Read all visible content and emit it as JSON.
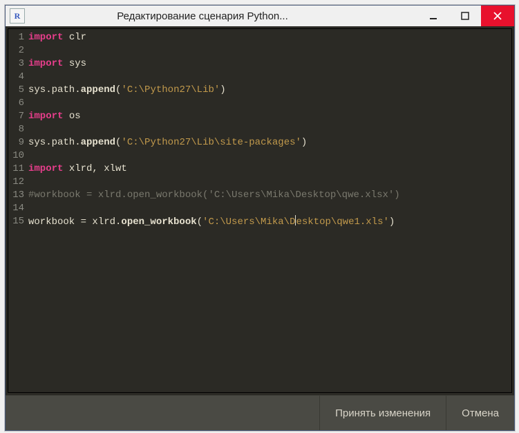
{
  "window": {
    "app_icon_letter": "R",
    "title": "Редактирование сценария Python..."
  },
  "code": {
    "lines": [
      {
        "n": 1,
        "tokens": [
          {
            "t": "kw",
            "v": "import"
          },
          {
            "t": "plain",
            "v": " clr"
          }
        ]
      },
      {
        "n": 2,
        "tokens": []
      },
      {
        "n": 3,
        "tokens": [
          {
            "t": "kw",
            "v": "import"
          },
          {
            "t": "plain",
            "v": " sys"
          }
        ]
      },
      {
        "n": 4,
        "tokens": []
      },
      {
        "n": 5,
        "tokens": [
          {
            "t": "plain",
            "v": "sys.path."
          },
          {
            "t": "fn",
            "v": "append"
          },
          {
            "t": "plain",
            "v": "("
          },
          {
            "t": "str",
            "v": "'C:\\Python27\\Lib'"
          },
          {
            "t": "plain",
            "v": ")"
          }
        ]
      },
      {
        "n": 6,
        "tokens": []
      },
      {
        "n": 7,
        "tokens": [
          {
            "t": "kw",
            "v": "import"
          },
          {
            "t": "plain",
            "v": " os"
          }
        ]
      },
      {
        "n": 8,
        "tokens": []
      },
      {
        "n": 9,
        "tokens": [
          {
            "t": "plain",
            "v": "sys.path."
          },
          {
            "t": "fn",
            "v": "append"
          },
          {
            "t": "plain",
            "v": "("
          },
          {
            "t": "str",
            "v": "'C:\\Python27\\Lib\\site-packages'"
          },
          {
            "t": "plain",
            "v": ")"
          }
        ]
      },
      {
        "n": 10,
        "tokens": []
      },
      {
        "n": 11,
        "tokens": [
          {
            "t": "kw",
            "v": "import"
          },
          {
            "t": "plain",
            "v": " xlrd, xlwt"
          }
        ]
      },
      {
        "n": 12,
        "tokens": []
      },
      {
        "n": 13,
        "tokens": [
          {
            "t": "cmt",
            "v": "#workbook = xlrd.open_workbook('C:\\Users\\Mika\\Desktop\\qwe.xlsx')"
          }
        ]
      },
      {
        "n": 14,
        "tokens": []
      },
      {
        "n": 15,
        "tokens": [
          {
            "t": "plain",
            "v": "workbook = xlrd."
          },
          {
            "t": "fn",
            "v": "open_workbook"
          },
          {
            "t": "plain",
            "v": "("
          },
          {
            "t": "str",
            "v": "'C:\\Users\\Mika\\D"
          },
          {
            "t": "caret"
          },
          {
            "t": "str",
            "v": "esktop\\qwe1.xls'"
          },
          {
            "t": "plain",
            "v": ")"
          }
        ]
      }
    ]
  },
  "footer": {
    "accept_label": "Принять изменения",
    "cancel_label": "Отмена"
  }
}
